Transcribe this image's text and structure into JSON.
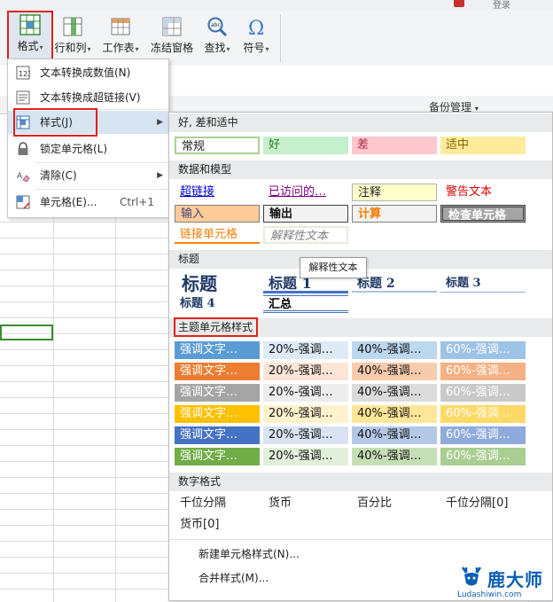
{
  "window": {
    "login_text": "登录"
  },
  "ribbon": {
    "buttons": [
      {
        "label": "格式",
        "icon": "format-table-icon"
      },
      {
        "label": "行和列",
        "icon": "rows-columns-icon"
      },
      {
        "label": "工作表",
        "icon": "worksheet-icon"
      },
      {
        "label": "冻结窗格",
        "icon": "freeze-panes-icon"
      },
      {
        "label": "查找",
        "icon": "find-magnifier-icon"
      },
      {
        "label": "符号",
        "icon": "omega-symbol-icon"
      }
    ],
    "dropdown_glyph": "▾"
  },
  "menu1": {
    "items": [
      {
        "label": "文本转换成数值(N)",
        "icon": "text-to-number-icon",
        "shortcut": ""
      },
      {
        "label": "文本转换成超链接(V)",
        "icon": "text-to-hyperlink-icon",
        "shortcut": ""
      },
      {
        "label": "样式(J)",
        "icon": "style-icon",
        "shortcut": "",
        "arrow": "▶"
      },
      {
        "label": "锁定单元格(L)",
        "icon": "lock-icon",
        "shortcut": ""
      },
      {
        "label": "清除(C)",
        "icon": "eraser-icon",
        "shortcut": "",
        "arrow": "▶"
      },
      {
        "label": "单元格(E)...",
        "icon": "cell-format-icon",
        "shortcut": "Ctrl+1"
      }
    ]
  },
  "sheet": {
    "backup_label": "备份管理",
    "dropdown_glyph": "▾"
  },
  "gallery": {
    "sections": {
      "good_bad": "好, 差和适中",
      "data_model": "数据和模型",
      "titles": "标题",
      "theme": "主题单元格样式",
      "number": "数字格式"
    },
    "good_bad": [
      "常规",
      "好",
      "差",
      "适中"
    ],
    "data_model_row1": [
      "超链接",
      "已访问的…",
      "注释",
      "警告文本"
    ],
    "data_model_row2": [
      "输入",
      "输出",
      "计算",
      "检查单元格"
    ],
    "data_model_row3": [
      "链接单元格",
      "解释性文本"
    ],
    "titles_row1": [
      "标题",
      "标题 1",
      "标题 2",
      "标题 3"
    ],
    "titles_row2": [
      "标题 4",
      "汇总"
    ],
    "theme_cols": [
      "强调文字…",
      "20%-强调…",
      "40%-强调…",
      "60%-强调…"
    ],
    "theme_colors": [
      "#5b9bd5",
      "#ed7d31",
      "#a5a5a5",
      "#ffc000",
      "#4472c4",
      "#70ad47"
    ],
    "number_formats": [
      "千位分隔",
      "货币",
      "百分比",
      "千位分隔[0]",
      "货币[0]"
    ],
    "tooltip": "解释性文本",
    "new_style": "新建单元格样式(N)...",
    "merge_style": "合并样式(M)..."
  },
  "logo": {
    "brand": "鹿大师",
    "url": "Ludashiwin.com"
  }
}
